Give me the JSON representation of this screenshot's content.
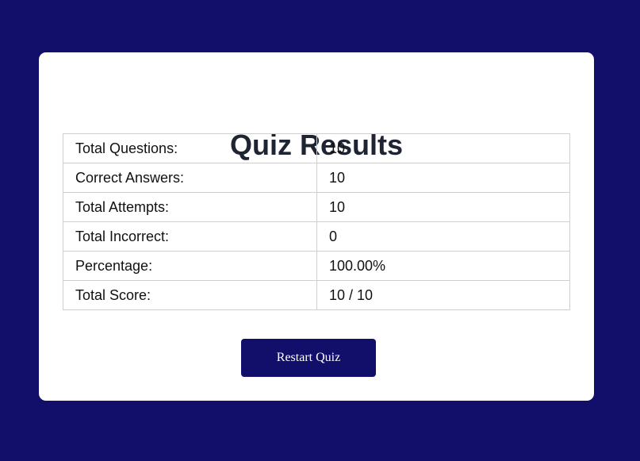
{
  "page": {
    "title": "Quiz Results",
    "background_color": "#120f6b",
    "card_color": "#ffffff"
  },
  "results": {
    "rows": [
      {
        "label": "Total Questions:",
        "value": "10"
      },
      {
        "label": "Correct Answers:",
        "value": "10"
      },
      {
        "label": "Total Attempts:",
        "value": "10"
      },
      {
        "label": "Total Incorrect:",
        "value": "0"
      },
      {
        "label": "Percentage:",
        "value": "100.00%"
      },
      {
        "label": "Total Score:",
        "value": "10 / 10"
      }
    ]
  },
  "actions": {
    "restart_label": "Restart Quiz",
    "button_color": "#120f6b"
  }
}
